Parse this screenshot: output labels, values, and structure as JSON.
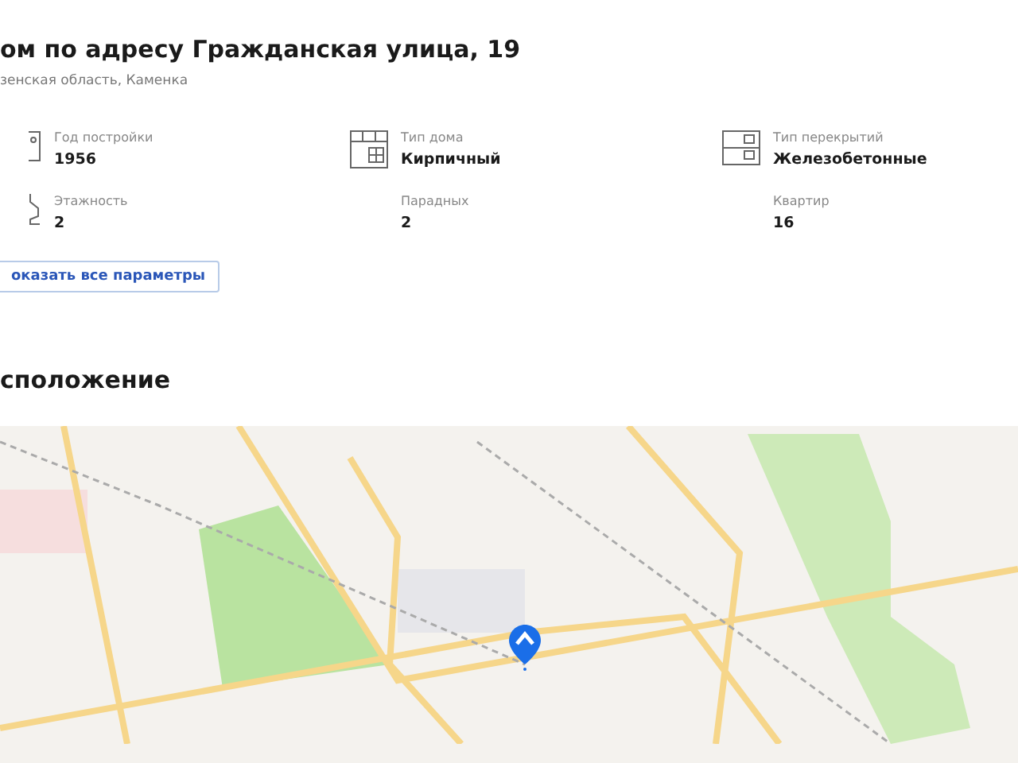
{
  "header": {
    "title": "ом по адресу Гражданская улица, 19",
    "subtitle": "зенская область, Каменка"
  },
  "params": [
    {
      "label": "Год постройки",
      "value": "1956",
      "kind": "year"
    },
    {
      "label": "Тип дома",
      "value": "Кирпичный",
      "kind": "type"
    },
    {
      "label": "Тип перекрытий",
      "value": "Железобетонные",
      "kind": "floors"
    },
    {
      "label": "Этажность",
      "value": "2",
      "kind": "storeys"
    },
    {
      "label": "Парадных",
      "value": "2",
      "kind": "plain"
    },
    {
      "label": "Квартир",
      "value": "16",
      "kind": "plain"
    }
  ],
  "show_all_button": "оказать все параметры",
  "location": {
    "heading": "сположение"
  }
}
